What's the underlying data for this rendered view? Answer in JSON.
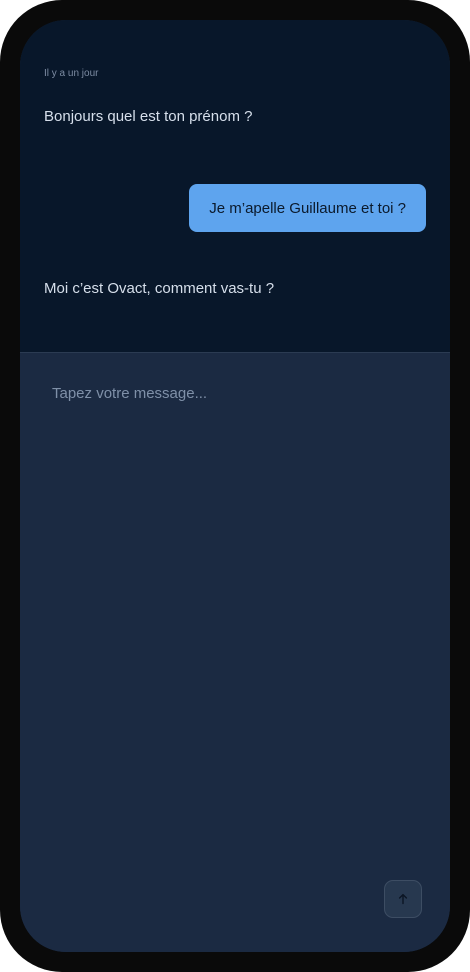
{
  "chat": {
    "timestamp": "Il y a un jour",
    "messages": [
      {
        "sender": "other",
        "text": "Bonjours quel est ton prénom ?"
      },
      {
        "sender": "me",
        "text": "Je m’apelle Guillaume et toi ?"
      },
      {
        "sender": "other",
        "text": "Moi c’est Ovact, comment vas-tu ?"
      }
    ]
  },
  "composer": {
    "placeholder": "Tapez votre message...",
    "value": "",
    "send_icon": "arrow-up-icon"
  },
  "colors": {
    "chat_background": "#08172a",
    "composer_background": "#1b2a42",
    "outgoing_bubble": "#5ea4ee",
    "frame": "#0a0a0a"
  }
}
